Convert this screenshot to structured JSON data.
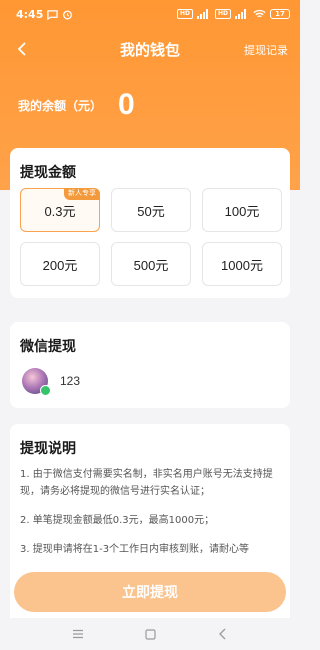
{
  "status_bar": {
    "time": "4:45",
    "signal_box_1": "HD",
    "signal_box_2": "HD",
    "battery": "17"
  },
  "nav": {
    "title": "我的钱包",
    "right_label": "提现记录"
  },
  "balance": {
    "label": "我的余额（元）",
    "value": "0"
  },
  "amount_section": {
    "title": "提现金额",
    "options": [
      {
        "label": "0.3元",
        "tag": "新人专享",
        "selected": true
      },
      {
        "label": "50元",
        "tag": "",
        "selected": false
      },
      {
        "label": "100元",
        "tag": "",
        "selected": false
      },
      {
        "label": "200元",
        "tag": "",
        "selected": false
      },
      {
        "label": "500元",
        "tag": "",
        "selected": false
      },
      {
        "label": "1000元",
        "tag": "",
        "selected": false
      }
    ]
  },
  "wechat_section": {
    "title": "微信提现",
    "user_name": "123"
  },
  "desc_section": {
    "title": "提现说明",
    "items": [
      "1. 由于微信支付需要实名制，非实名用户账号无法支持提现，请务必将提现的微信号进行实名认证；",
      "2. 单笔提现金额最低0.3元，最高1000元；",
      "3. 提现申请将在1-3个工作日内审核到账，请耐心等"
    ]
  },
  "submit_button": "立即提现",
  "colors": {
    "accent": "#ff9733",
    "button": "#fbc38d",
    "selected_border": "#f8a34f"
  }
}
